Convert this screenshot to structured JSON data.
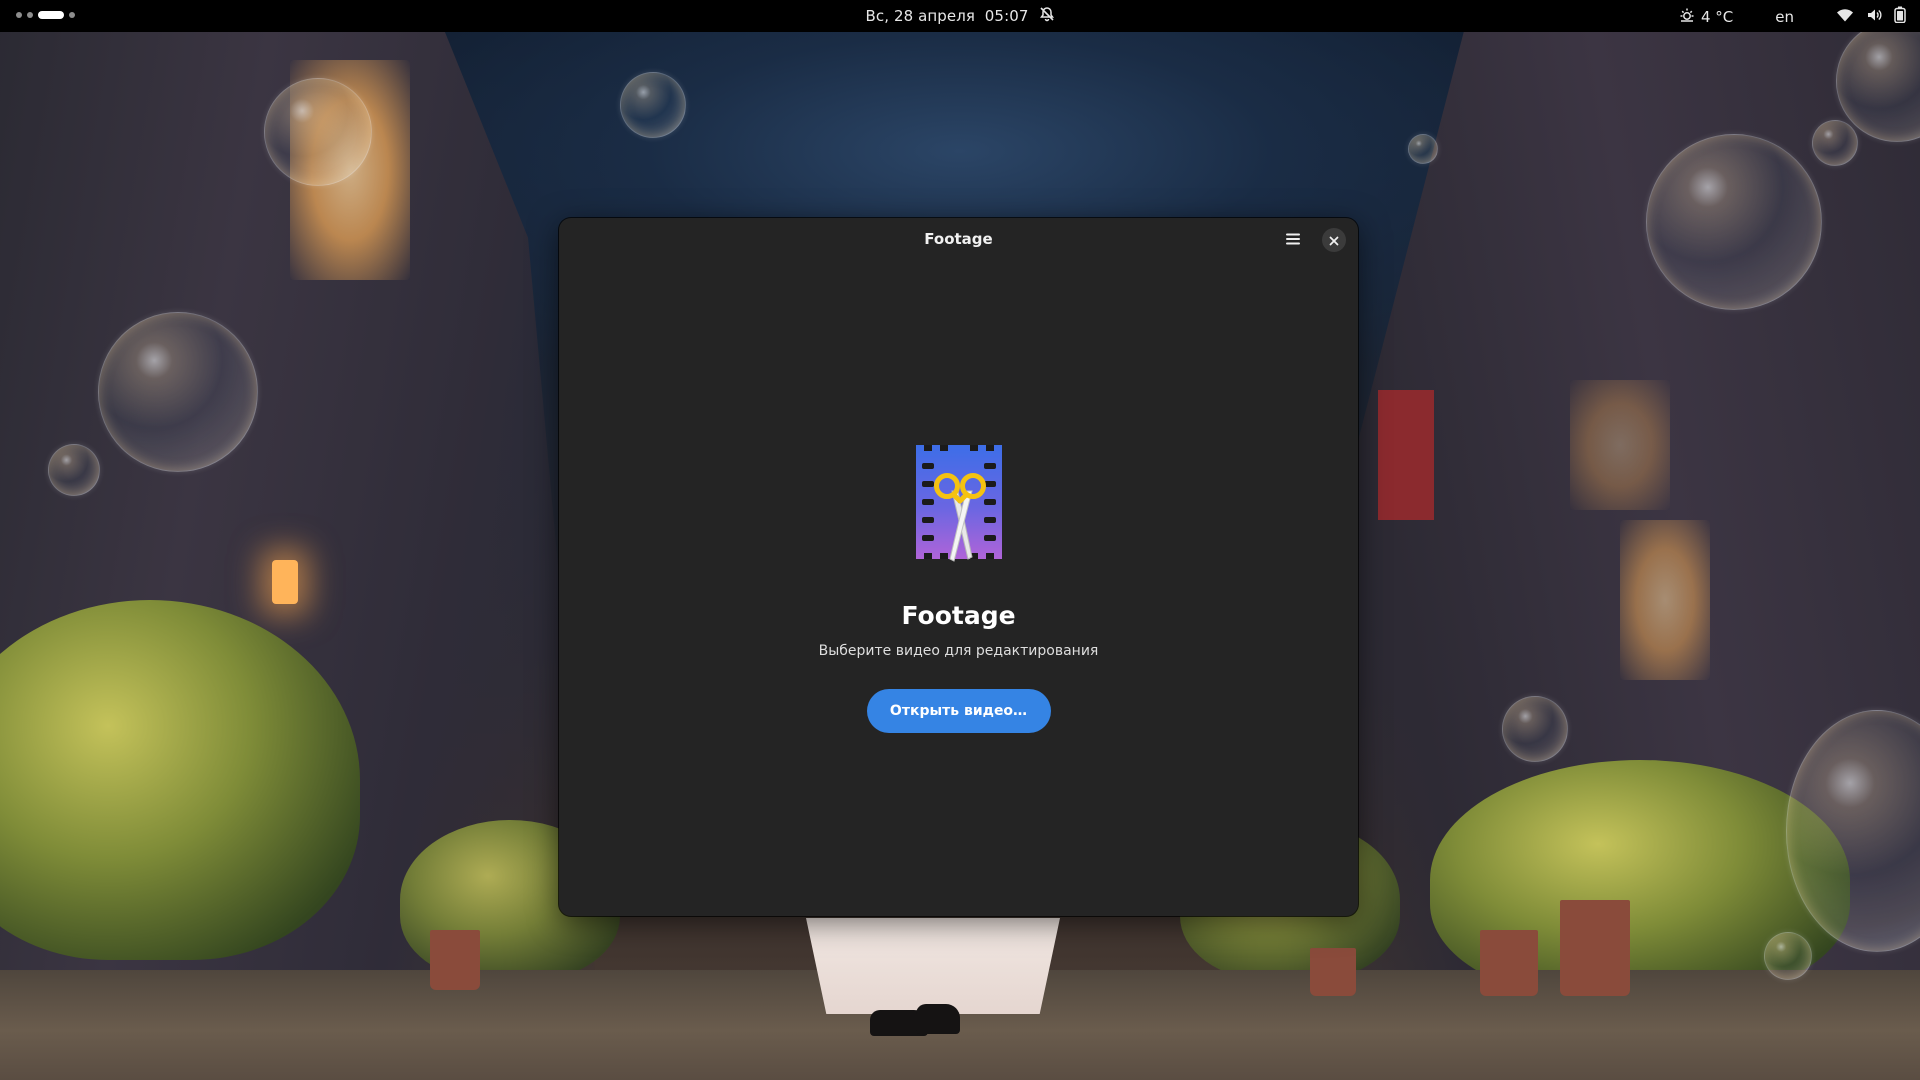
{
  "topbar": {
    "datetime": "Вс, 28 апреля  05:07",
    "weather_temp": "4 °C",
    "keyboard_layout": "en",
    "icons": [
      "notifications-disabled-icon",
      "weather-icon",
      "wifi-icon",
      "volume-icon",
      "battery-icon"
    ]
  },
  "window": {
    "title": "Footage",
    "menu_icon": "hamburger-menu-icon",
    "close_icon": "close-icon"
  },
  "status_page": {
    "app_icon": "footage-app-icon",
    "title": "Footage",
    "description": "Выберите видео для редактирования",
    "open_button_label": "Открыть видео…"
  },
  "colors": {
    "accent": "#3584e4",
    "window_bg": "#242424",
    "topbar_bg": "#000000"
  }
}
